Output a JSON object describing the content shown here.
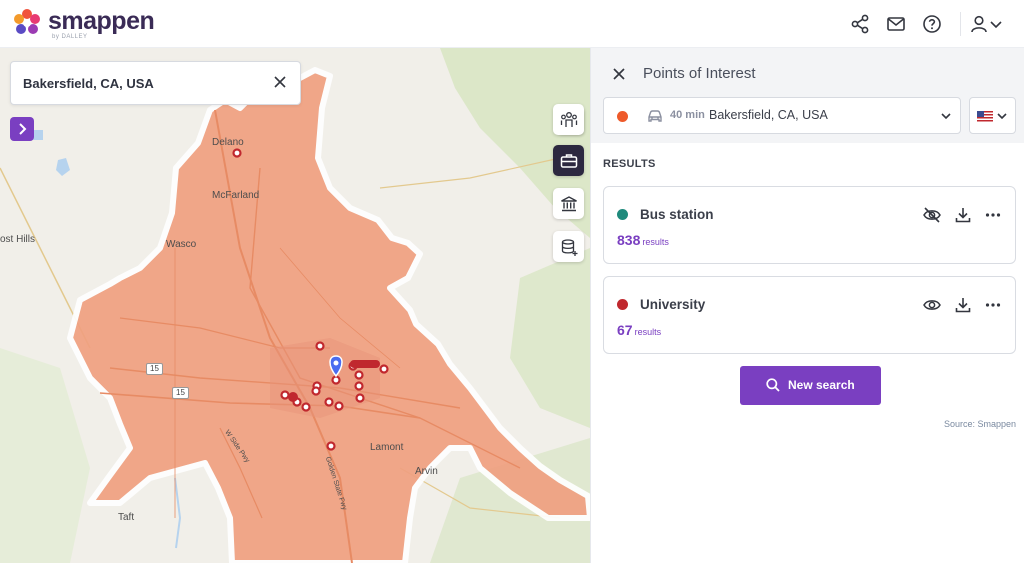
{
  "app": {
    "name": "smappen",
    "by_line": "by DALLEY"
  },
  "header": {
    "icons": [
      "share-icon",
      "mail-icon",
      "help-icon",
      "user-icon",
      "chevron-down-icon"
    ]
  },
  "map": {
    "search": {
      "value": "Bakersfield, CA, USA"
    },
    "places": [
      {
        "name": "Delano"
      },
      {
        "name": "McFarland"
      },
      {
        "name": "Wasco"
      },
      {
        "name": "Lamont"
      },
      {
        "name": "Arvin"
      },
      {
        "name": "Taft"
      },
      {
        "name": "ost Hills"
      }
    ],
    "road_labels": [
      "15",
      "15"
    ],
    "road_names": [
      "W Side Pwy",
      "Golden State Fwy"
    ],
    "colors": {
      "isochrone_fill": "#f0a080",
      "poi_marker": "#c0282e",
      "pin": "#4a6cf0",
      "water": "#b6d3ee",
      "vegetation": "#d9e6c4"
    },
    "tools": [
      "groups-icon",
      "briefcase-icon",
      "bank-icon",
      "database-add-icon"
    ]
  },
  "panel": {
    "title": "Points of Interest",
    "isochrone": {
      "time": "40 min",
      "location": "Bakersfield, CA, USA",
      "color": "#ee5a2a"
    },
    "results_label": "RESULTS",
    "results": [
      {
        "name": "Bus station",
        "count": "838",
        "unit": "results",
        "color": "#1f8a7c",
        "visibility": "hidden"
      },
      {
        "name": "University",
        "count": "67",
        "unit": "results",
        "color": "#c0282e",
        "visibility": "visible"
      }
    ],
    "new_search": "New search",
    "source": "Source: Smappen"
  }
}
